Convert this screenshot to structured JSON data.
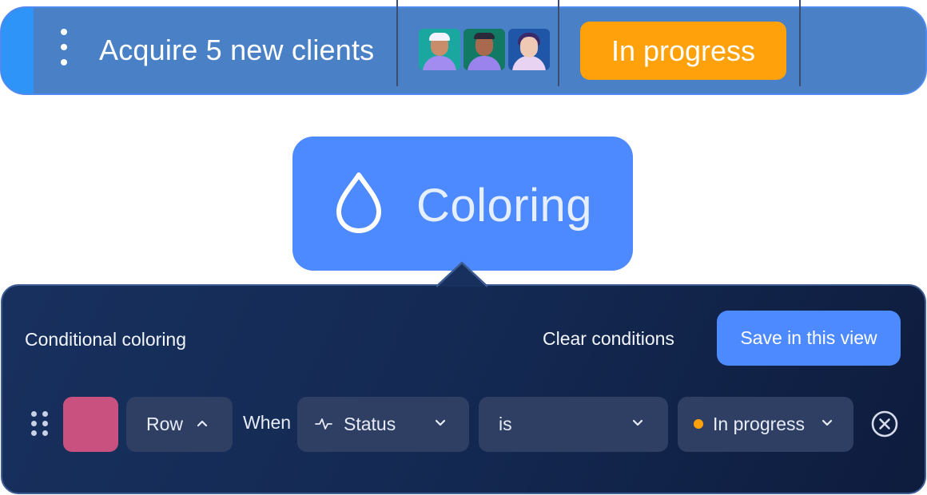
{
  "row": {
    "title": "Acquire 5 new clients",
    "status_label": "In progress",
    "status_color": "#ffa10a",
    "bar_color": "#4a80c6",
    "menu_icon": "vertical-dots-icon",
    "avatars": [
      {
        "name_icon": "avatar-man-cap",
        "bg": "#1aa7a0",
        "skin": "#c98d6b",
        "shirt": "#a28cf0",
        "hat": "#f3f3ff"
      },
      {
        "name_icon": "avatar-man-beard",
        "bg": "#127a64",
        "skin": "#a8694e",
        "shirt": "#9b83ee",
        "hat": "#2a2a3a"
      },
      {
        "name_icon": "avatar-woman",
        "bg": "#2056a8",
        "skin": "#f0c9b5",
        "shirt": "#e8d4f2",
        "hat": "#3a2a6a"
      }
    ]
  },
  "coloring": {
    "label": "Coloring",
    "icon": "drop-icon",
    "color": "#4d89ff"
  },
  "panel": {
    "title": "Conditional coloring",
    "clear_label": "Clear conditions",
    "save_label": "Save in this view",
    "condition": {
      "swatch_color": "#c8517f",
      "target": "Row",
      "when_label": "When",
      "field": "Status",
      "field_icon": "activity-pulse-icon",
      "operator": "is",
      "value": "In progress",
      "value_dot_color": "#ffa10a"
    }
  }
}
